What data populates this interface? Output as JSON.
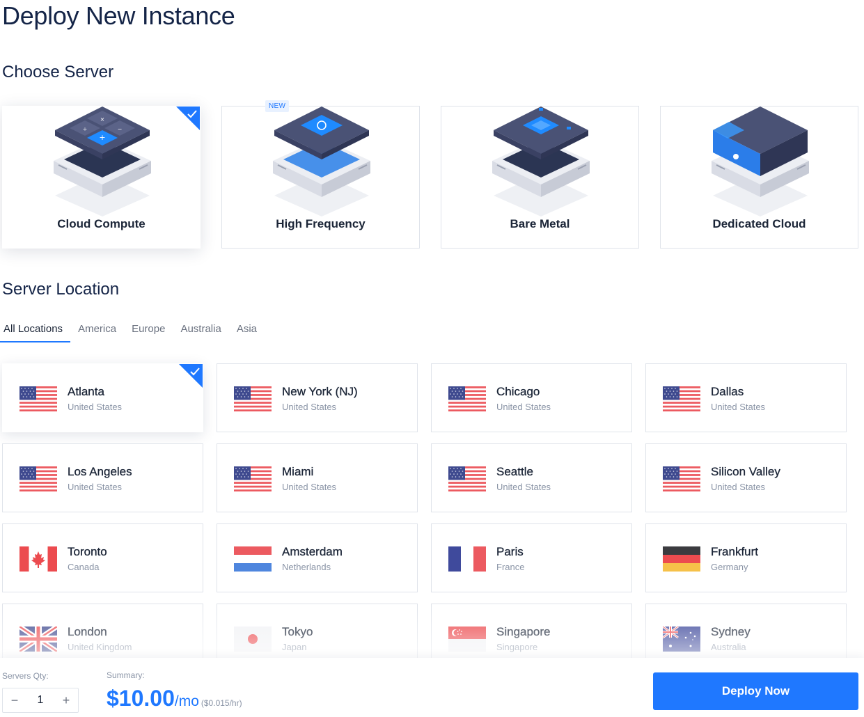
{
  "page": {
    "title": "Deploy New Instance"
  },
  "sections": {
    "server": "Choose Server",
    "location": "Server Location"
  },
  "server_types": [
    {
      "label": "Cloud Compute",
      "selected": true,
      "badge": ""
    },
    {
      "label": "High Frequency",
      "selected": false,
      "badge": "NEW"
    },
    {
      "label": "Bare Metal",
      "selected": false,
      "badge": ""
    },
    {
      "label": "Dedicated Cloud",
      "selected": false,
      "badge": ""
    }
  ],
  "tabs": [
    {
      "label": "All Locations",
      "active": true
    },
    {
      "label": "America",
      "active": false
    },
    {
      "label": "Europe",
      "active": false
    },
    {
      "label": "Australia",
      "active": false
    },
    {
      "label": "Asia",
      "active": false
    }
  ],
  "locations": [
    {
      "city": "Atlanta",
      "country": "United States",
      "flag": "us-flag-icon",
      "selected": true
    },
    {
      "city": "New York (NJ)",
      "country": "United States",
      "flag": "us-flag-icon",
      "selected": false
    },
    {
      "city": "Chicago",
      "country": "United States",
      "flag": "us-flag-icon",
      "selected": false
    },
    {
      "city": "Dallas",
      "country": "United States",
      "flag": "us-flag-icon",
      "selected": false
    },
    {
      "city": "Los Angeles",
      "country": "United States",
      "flag": "us-flag-icon",
      "selected": false
    },
    {
      "city": "Miami",
      "country": "United States",
      "flag": "us-flag-icon",
      "selected": false
    },
    {
      "city": "Seattle",
      "country": "United States",
      "flag": "us-flag-icon",
      "selected": false
    },
    {
      "city": "Silicon Valley",
      "country": "United States",
      "flag": "us-flag-icon",
      "selected": false
    },
    {
      "city": "Toronto",
      "country": "Canada",
      "flag": "canada-flag-icon",
      "selected": false
    },
    {
      "city": "Amsterdam",
      "country": "Netherlands",
      "flag": "netherlands-flag-icon",
      "selected": false
    },
    {
      "city": "Paris",
      "country": "France",
      "flag": "france-flag-icon",
      "selected": false
    },
    {
      "city": "Frankfurt",
      "country": "Germany",
      "flag": "germany-flag-icon",
      "selected": false
    },
    {
      "city": "London",
      "country": "United Kingdom",
      "flag": "uk-flag-icon",
      "selected": false
    },
    {
      "city": "Tokyo",
      "country": "Japan",
      "flag": "japan-flag-icon",
      "selected": false
    },
    {
      "city": "Singapore",
      "country": "Singapore",
      "flag": "singapore-flag-icon",
      "selected": false
    },
    {
      "city": "Sydney",
      "country": "Australia",
      "flag": "australia-flag-icon",
      "selected": false
    }
  ],
  "footer": {
    "qty_label": "Servers Qty:",
    "qty_value": "1",
    "minus": "−",
    "plus": "+",
    "summary_label": "Summary:",
    "price": "$10.00",
    "per": "/mo",
    "hourly": "($0.015/hr)",
    "deploy_label": "Deploy Now"
  },
  "colors": {
    "accent": "#1f78ff",
    "title": "#142447",
    "border": "#dfe3ea",
    "muted": "#8a94a6"
  }
}
